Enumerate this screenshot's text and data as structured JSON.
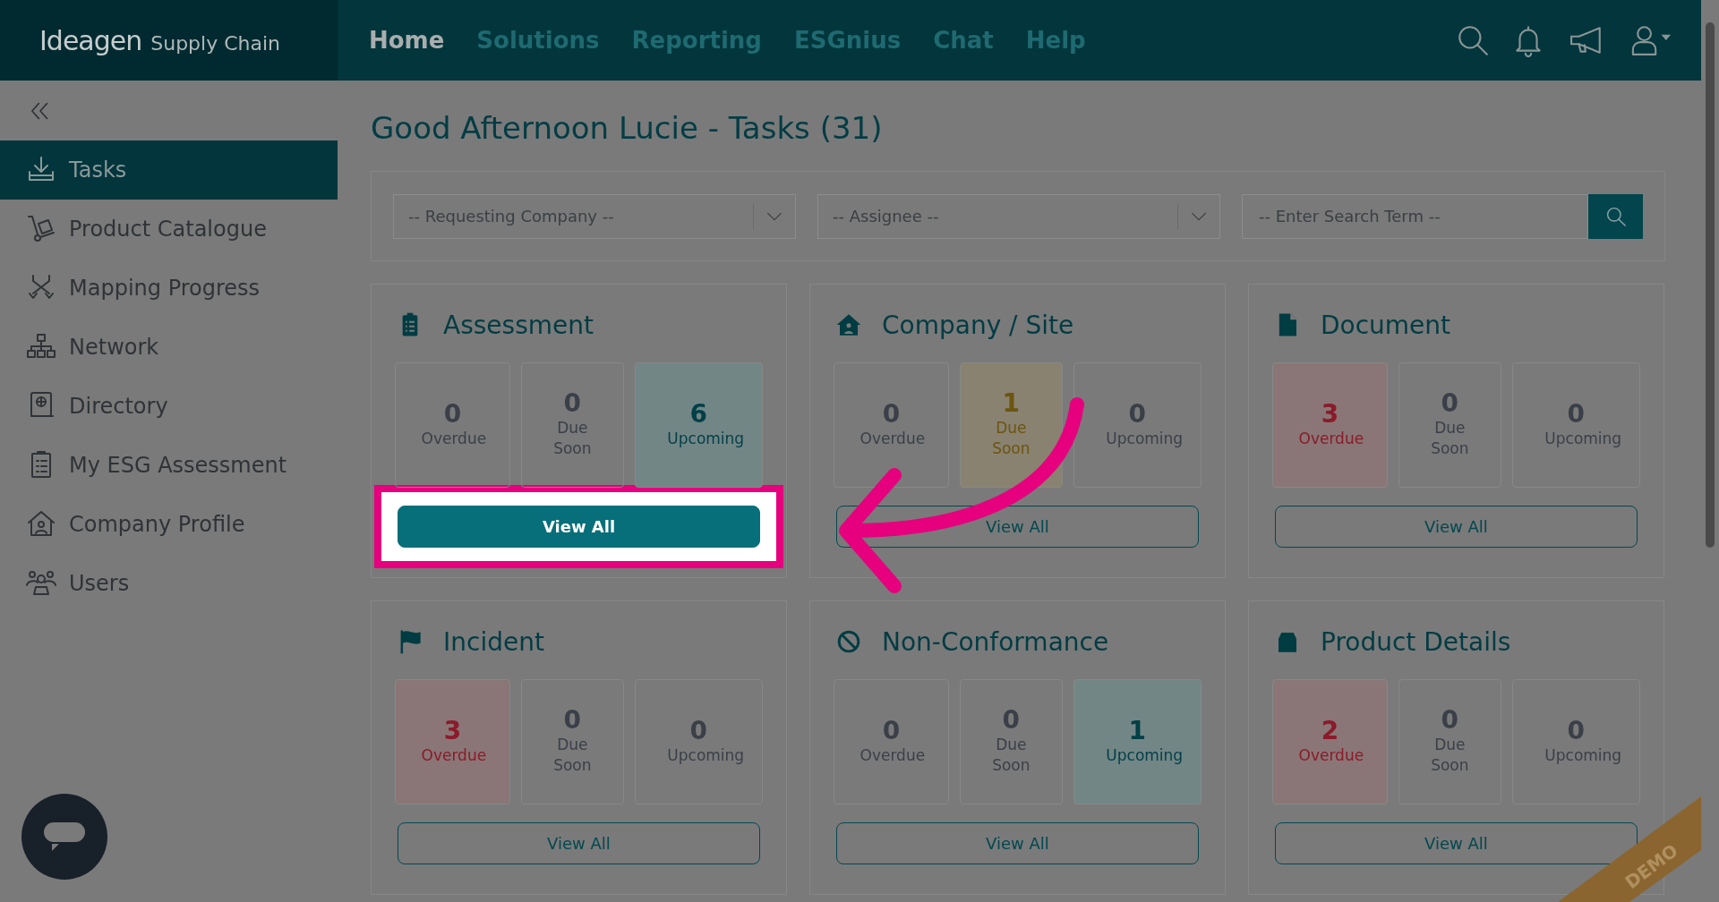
{
  "header": {
    "logo": {
      "brand": "Ideagen",
      "product": "Supply Chain"
    },
    "nav": [
      {
        "label": "Home",
        "selected": true
      },
      {
        "label": "Solutions",
        "selected": false
      },
      {
        "label": "Reporting",
        "selected": false
      },
      {
        "label": "ESGnius",
        "selected": false
      },
      {
        "label": "Chat",
        "selected": false
      },
      {
        "label": "Help",
        "selected": false
      }
    ]
  },
  "sidebar": {
    "items": [
      {
        "label": "Tasks",
        "selected": true
      },
      {
        "label": "Product Catalogue",
        "selected": false
      },
      {
        "label": "Mapping Progress",
        "selected": false
      },
      {
        "label": "Network",
        "selected": false
      },
      {
        "label": "Directory",
        "selected": false
      },
      {
        "label": "My ESG Assessment",
        "selected": false
      },
      {
        "label": "Company Profile",
        "selected": false
      },
      {
        "label": "Users",
        "selected": false
      }
    ]
  },
  "page_title": "Good Afternoon Lucie - Tasks (31)",
  "filters": {
    "company": {
      "placeholder": "-- Requesting Company --"
    },
    "assignee": {
      "placeholder": "-- Assignee --"
    },
    "search": {
      "placeholder": "-- Enter Search Term --"
    }
  },
  "cards": [
    {
      "title": "Assessment",
      "spotlight": true,
      "button": "View All",
      "stats": [
        {
          "count": "0",
          "label": "Overdue",
          "kind": "overdue",
          "highlighted": false
        },
        {
          "count": "0",
          "label": "Due Soon",
          "kind": "due",
          "highlighted": false
        },
        {
          "count": "6",
          "label": "Upcoming",
          "kind": "upcoming",
          "highlighted": true
        }
      ]
    },
    {
      "title": "Company / Site",
      "spotlight": false,
      "button": "View All",
      "stats": [
        {
          "count": "0",
          "label": "Overdue",
          "kind": "overdue",
          "highlighted": false
        },
        {
          "count": "1",
          "label": "Due Soon",
          "kind": "due",
          "highlighted": true
        },
        {
          "count": "0",
          "label": "Upcoming",
          "kind": "upcoming",
          "highlighted": false
        }
      ]
    },
    {
      "title": "Document",
      "spotlight": false,
      "button": "View All",
      "stats": [
        {
          "count": "3",
          "label": "Overdue",
          "kind": "overdue",
          "highlighted": true
        },
        {
          "count": "0",
          "label": "Due Soon",
          "kind": "due",
          "highlighted": false
        },
        {
          "count": "0",
          "label": "Upcoming",
          "kind": "upcoming",
          "highlighted": false
        }
      ]
    },
    {
      "title": "Incident",
      "spotlight": false,
      "button": "View All",
      "stats": [
        {
          "count": "3",
          "label": "Overdue",
          "kind": "overdue",
          "highlighted": true
        },
        {
          "count": "0",
          "label": "Due Soon",
          "kind": "due",
          "highlighted": false
        },
        {
          "count": "0",
          "label": "Upcoming",
          "kind": "upcoming",
          "highlighted": false
        }
      ]
    },
    {
      "title": "Non-Conformance",
      "spotlight": false,
      "button": "View All",
      "stats": [
        {
          "count": "0",
          "label": "Overdue",
          "kind": "overdue",
          "highlighted": false
        },
        {
          "count": "0",
          "label": "Due Soon",
          "kind": "due",
          "highlighted": false
        },
        {
          "count": "1",
          "label": "Upcoming",
          "kind": "upcoming",
          "highlighted": true
        }
      ]
    },
    {
      "title": "Product Details",
      "spotlight": false,
      "button": "View All",
      "stats": [
        {
          "count": "2",
          "label": "Overdue",
          "kind": "overdue",
          "highlighted": true
        },
        {
          "count": "0",
          "label": "Due Soon",
          "kind": "due",
          "highlighted": false
        },
        {
          "count": "0",
          "label": "Upcoming",
          "kind": "upcoming",
          "highlighted": false
        }
      ]
    }
  ],
  "demo_ribbon": "DEMO"
}
